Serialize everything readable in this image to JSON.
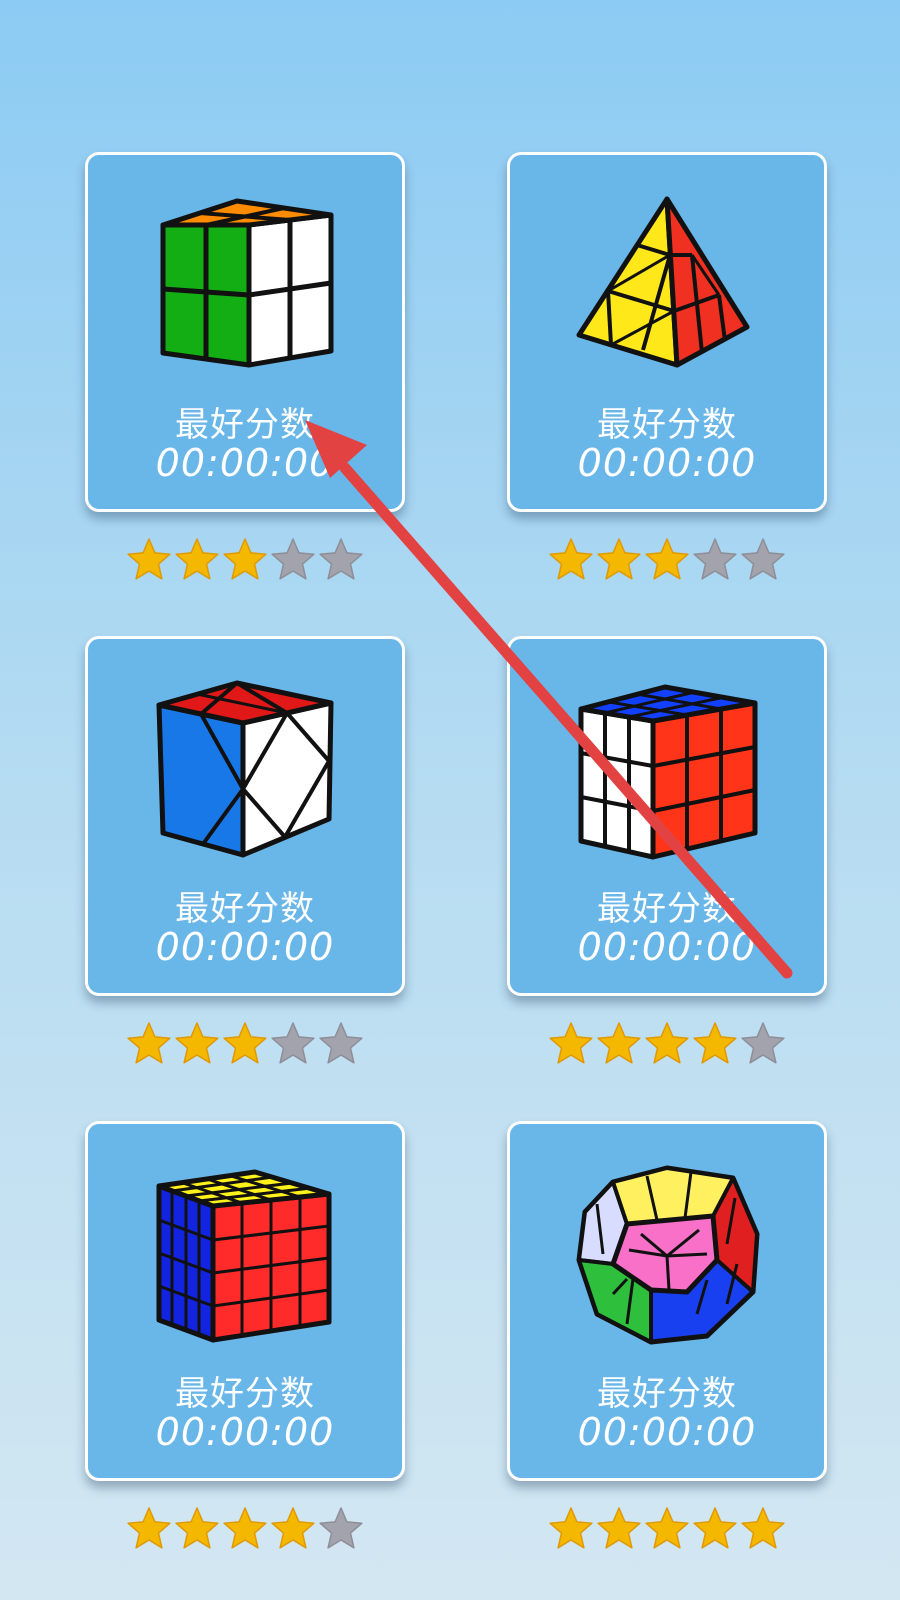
{
  "cards": [
    {
      "puzzle": "2x2-cube-icon",
      "label": "最好分数",
      "time": "00:00:00",
      "rating": 3,
      "max_rating": 5
    },
    {
      "puzzle": "pyraminx-icon",
      "label": "最好分数",
      "time": "00:00:00",
      "rating": 3,
      "max_rating": 5
    },
    {
      "puzzle": "skewb-icon",
      "label": "最好分数",
      "time": "00:00:00",
      "rating": 3,
      "max_rating": 5
    },
    {
      "puzzle": "3x3-cube-icon",
      "label": "最好分数",
      "time": "00:00:00",
      "rating": 4,
      "max_rating": 5
    },
    {
      "puzzle": "4x4-cube-icon",
      "label": "最好分数",
      "time": "00:00:00",
      "rating": 4,
      "max_rating": 5
    },
    {
      "puzzle": "megaminx-icon",
      "label": "最好分数",
      "time": "00:00:00",
      "rating": 5,
      "max_rating": 5
    }
  ],
  "colors": {
    "card_bg": "#69b6e8",
    "star_on": "#f5b800",
    "star_off": "#a3a3ad",
    "annotation_arrow": "#e34242"
  }
}
